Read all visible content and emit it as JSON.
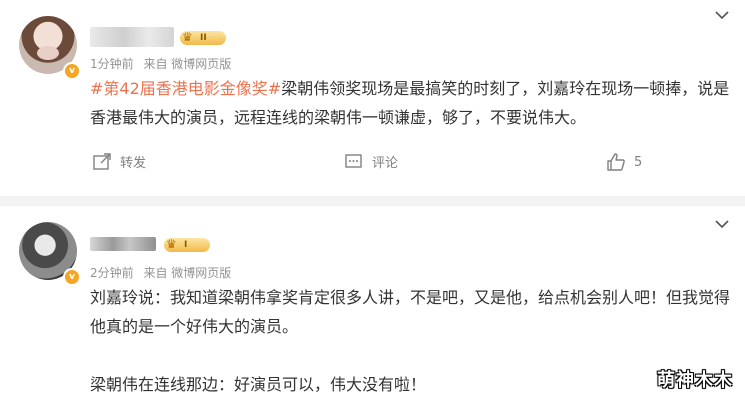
{
  "posts": [
    {
      "level_badge": "II",
      "time": "1分钟前",
      "source": "来自 微博网页版",
      "topic": "#第42届香港电影金像奖#",
      "text": "梁朝伟领奖现场是最搞笑的时刻了，刘嘉玲在现场一顿捧，说是香港最伟大的演员，远程连线的梁朝伟一顿谦虚，够了，不要说伟大。",
      "actions": {
        "repost_label": "转发",
        "comment_label": "评论",
        "like_count": "5"
      }
    },
    {
      "level_badge": "I",
      "time": "2分钟前",
      "source": "来自 微博网页版",
      "paragraph1": "刘嘉玲说：我知道梁朝伟拿奖肯定很多人讲，不是吧，又是他，给点机会别人吧！但我觉得他真的是一个好伟大的演员。",
      "paragraph2": "梁朝伟在连线那边：好演员可以，伟大没有啦！"
    }
  ],
  "watermark": "萌神木木",
  "colors": {
    "topic": "#eb7350",
    "meta": "#939393",
    "separator": "#f2f3f5"
  }
}
